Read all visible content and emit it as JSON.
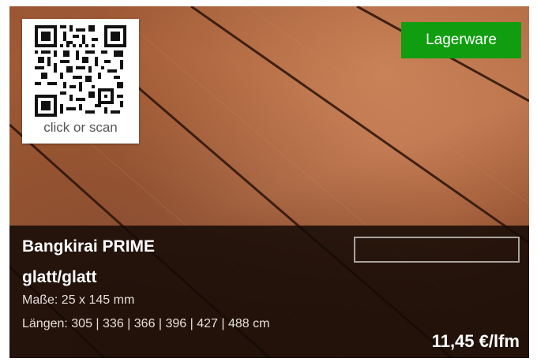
{
  "qr": {
    "caption": "click or scan"
  },
  "badge": {
    "label": "Lagerware",
    "color": "#109e10"
  },
  "product": {
    "title_line1": "Bangkirai PRIME",
    "title_line2": "glatt/glatt",
    "dimensions": "Maße: 25 x 145  mm",
    "lengths": "Längen: 305 | 336 | 366 | 396 | 427 | 488 cm",
    "price": "11,45 €/lfm"
  },
  "icons": {
    "qr_code": "qr-code-icon"
  }
}
